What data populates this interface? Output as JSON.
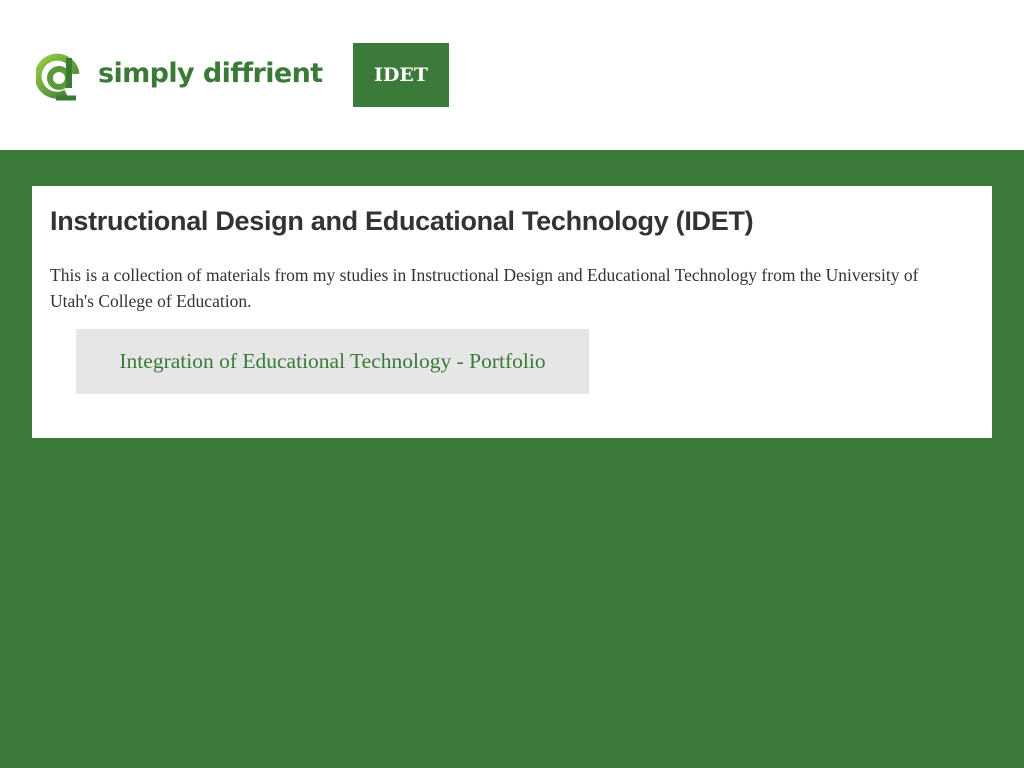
{
  "header": {
    "logo_text": "simply diffrient",
    "logo_icon": "letter-d-logo-icon",
    "nav_tab_label": "IDET"
  },
  "main": {
    "title": "Instructional Design and Educational Technology (IDET)",
    "description": "This is a collection of materials from my studies in Instructional Design and Educational Technology from the University of Utah's College of Education.",
    "portfolio_link_label": "Integration of Educational Technology - Portfolio"
  },
  "colors": {
    "brand_green": "#3b7a38",
    "logo_light_green": "#8ec641",
    "text_dark": "#333333",
    "link_bg": "#e6e6e6"
  }
}
